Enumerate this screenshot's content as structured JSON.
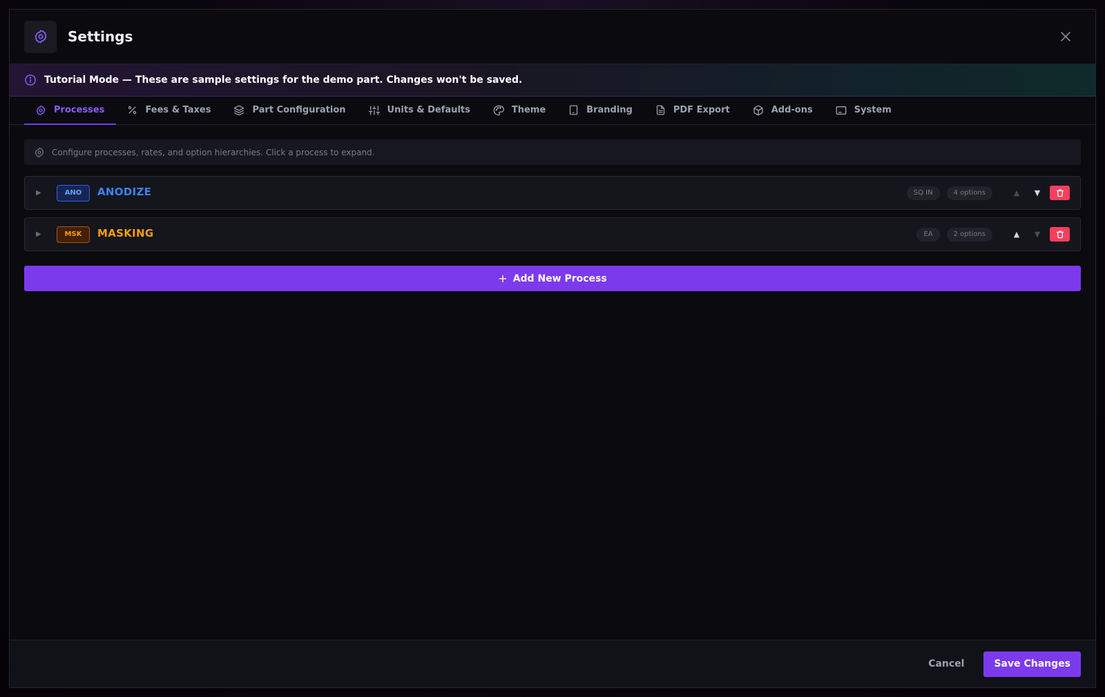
{
  "header": {
    "title": "Settings",
    "icon": "gear-icon",
    "close_icon": "close-icon"
  },
  "banner": {
    "icon": "info-icon",
    "text": "Tutorial Mode — These are sample settings for the demo part. Changes won't be saved."
  },
  "tabs": [
    {
      "label": "Processes",
      "icon": "gear-icon",
      "active": true
    },
    {
      "label": "Fees & Taxes",
      "icon": "percent-icon",
      "active": false
    },
    {
      "label": "Part Configuration",
      "icon": "layers-icon",
      "active": false
    },
    {
      "label": "Units & Defaults",
      "icon": "sliders-icon",
      "active": false
    },
    {
      "label": "Theme",
      "icon": "palette-icon",
      "active": false
    },
    {
      "label": "Branding",
      "icon": "tablet-icon",
      "active": false
    },
    {
      "label": "PDF Export",
      "icon": "document-icon",
      "active": false
    },
    {
      "label": "Add-ons",
      "icon": "package-icon",
      "active": false
    },
    {
      "label": "System",
      "icon": "monitor-icon",
      "active": false
    }
  ],
  "hint": {
    "icon": "gear-icon",
    "text": "Configure processes, rates, and option hierarchies. Click a process to expand."
  },
  "processes": [
    {
      "code": "ANO",
      "name": "ANODIZE",
      "unit": "SQ IN",
      "options": "4 options",
      "color": "#3b82f6",
      "badge_bg": "#172554",
      "badge_border": "#2563eb",
      "move_up_enabled": false,
      "move_down_enabled": true
    },
    {
      "code": "MSK",
      "name": "MASKING",
      "unit": "EA",
      "options": "2 options",
      "color": "#f59e0b",
      "badge_bg": "#422006",
      "badge_border": "#b45309",
      "move_up_enabled": true,
      "move_down_enabled": false
    }
  ],
  "add_button": {
    "label": "Add New Process",
    "icon": "plus-icon"
  },
  "footer": {
    "cancel_label": "Cancel",
    "save_label": "Save Changes"
  },
  "colors": {
    "accent": "#7c3aed",
    "accent_text": "#8b5cf6",
    "danger": "#f43f5e"
  }
}
